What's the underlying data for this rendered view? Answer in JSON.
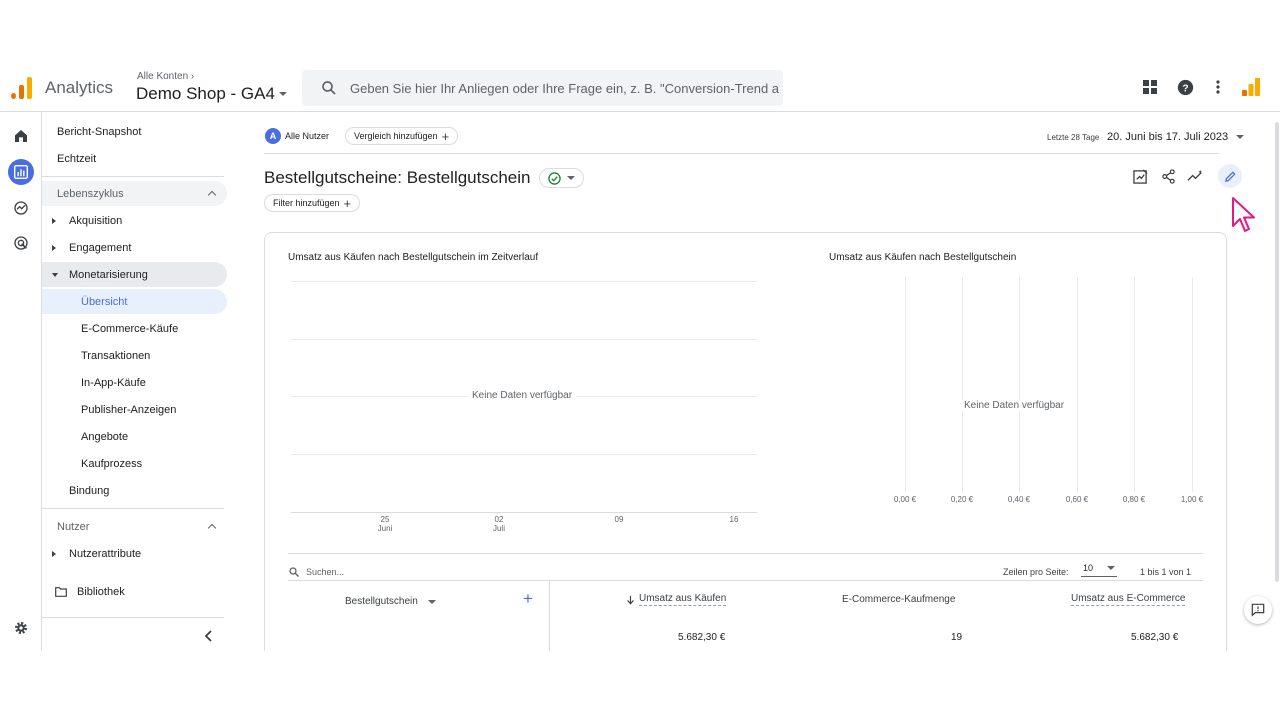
{
  "header": {
    "app_name": "Analytics",
    "account_crumb": "Alle Konten",
    "property_name": "Demo Shop - GA4",
    "search_placeholder": "Geben Sie hier Ihr Anliegen oder Ihre Frage ein, z. B. \"Conversion-Trend a...",
    "logo_colors": [
      "#F9AB00",
      "#E37400",
      "#E37400"
    ],
    "icons": [
      "apps-grid-icon",
      "help-icon",
      "more-vert-icon",
      "analytics-logo-icon"
    ]
  },
  "rail": {
    "icons": [
      "home-icon",
      "reports-icon",
      "explore-icon",
      "advertising-icon",
      "settings-icon"
    ],
    "active": "reports-icon"
  },
  "nav": {
    "snapshot": "Bericht-Snapshot",
    "realtime": "Echtzeit",
    "lifecycle": "Lebenszyklus",
    "acquisition": "Akquisition",
    "engagement": "Engagement",
    "monetization": "Monetarisierung",
    "monetization_items": [
      "Übersicht",
      "E-Commerce-Käufe",
      "Transaktionen",
      "In-App-Käufe",
      "Publisher-Anzeigen",
      "Angebote",
      "Kaufprozess"
    ],
    "retention": "Bindung",
    "user": "Nutzer",
    "user_attributes": "Nutzerattribute",
    "library": "Bibliothek"
  },
  "main": {
    "segment_avatar": "A",
    "segment": "Alle Nutzer",
    "compare": "Vergleich hinzufügen",
    "date_range_label": "Letzte 28 Tage",
    "date_range": "20. Juni bis 17. Juli 2023",
    "title": "Bestellgutscheine: Bestellgutschein",
    "add_filter": "Filter hinzufügen",
    "toolbar_icons": [
      "customize-report-icon",
      "share-icon",
      "insights-icon",
      "edit-pencil-icon"
    ],
    "accent_color": "#4a6ee0",
    "cursor_color": "#E6197F"
  },
  "charts": {
    "line_title": "Umsatz aus Käufen nach Bestellgutschein im Zeitverlauf",
    "line_no_data": "Keine Daten verfügbar",
    "line_x_ticks": [
      {
        "day": "25",
        "month": "Juni"
      },
      {
        "day": "02",
        "month": "Juli"
      },
      {
        "day": "09",
        "month": ""
      },
      {
        "day": "16",
        "month": ""
      }
    ],
    "bar_title": "Umsatz aus Käufen nach Bestellgutschein",
    "bar_no_data": "Keine Daten verfügbar",
    "bar_x_ticks": [
      "0,00 €",
      "0,20 €",
      "0,40 €",
      "0,60 €",
      "0,80 €",
      "1,00 €"
    ]
  },
  "table": {
    "search_placeholder": "Suchen...",
    "rows_per_page_label": "Zeilen pro Seite:",
    "rows_per_page": "10",
    "pagination": "1 bis 1 von 1",
    "dimension_header": "Bestellgutschein",
    "columns": [
      "Umsatz aus Käufen",
      "E-Commerce-Kaufmenge",
      "Umsatz aus E-Commerce"
    ],
    "totals": [
      "5.682,30 €",
      "19",
      "5.682,30 €"
    ]
  }
}
